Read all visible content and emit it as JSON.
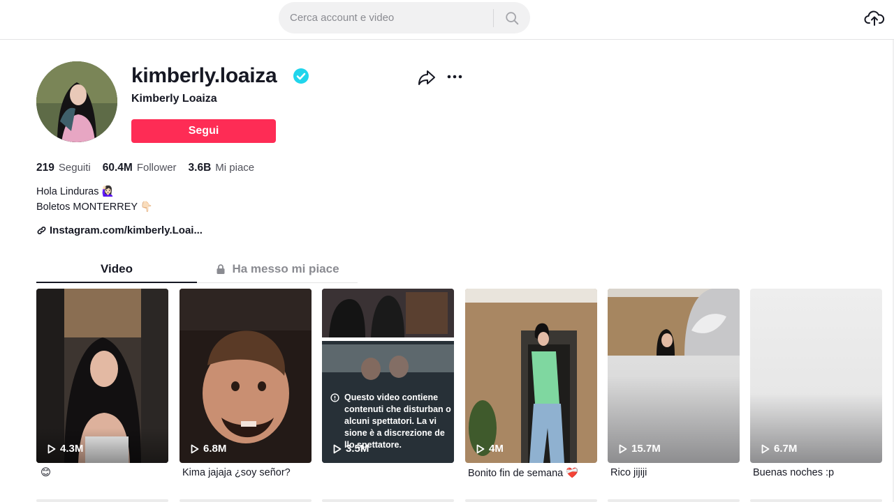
{
  "header": {
    "search_placeholder": "Cerca account e video",
    "search_icon": "search-icon",
    "upload_icon": "cloud-upload-icon"
  },
  "profile": {
    "username": "kimberly.loaiza",
    "nickname": "Kimberly Loaiza",
    "verified": true,
    "follow_label": "Segui",
    "accent_color": "#fe2c55",
    "verified_color": "#20d5ec",
    "stats": [
      {
        "value": "219",
        "label": "Seguiti"
      },
      {
        "value": "60.4M",
        "label": "Follower"
      },
      {
        "value": "3.6B",
        "label": "Mi piace"
      }
    ],
    "bio_line1": "Hola Linduras 🙋🏻‍♀️",
    "bio_line2": "Boletos MONTERREY 👇🏻",
    "link": "Instagram.com/kimberly.Loai..."
  },
  "tabs": [
    {
      "label": "Video",
      "active": true
    },
    {
      "label": "Ha messo mi piace",
      "active": false,
      "locked": true
    }
  ],
  "videos": [
    {
      "views": "4.3M",
      "caption": "😊"
    },
    {
      "views": "6.8M",
      "caption": "Kima jajaja ¿soy señor?"
    },
    {
      "views": "3.5M",
      "caption": "",
      "warning": "Questo video contiene contenuti che disturban o alcuni spettatori. La vi sione è a discrezione de llo spettatore."
    },
    {
      "views": "4M",
      "caption": "Bonito fin de semana ❤️‍🩹"
    },
    {
      "views": "15.7M",
      "caption": "Rico jijiji"
    },
    {
      "views": "6.7M",
      "caption": "Buenas noches :p"
    }
  ]
}
